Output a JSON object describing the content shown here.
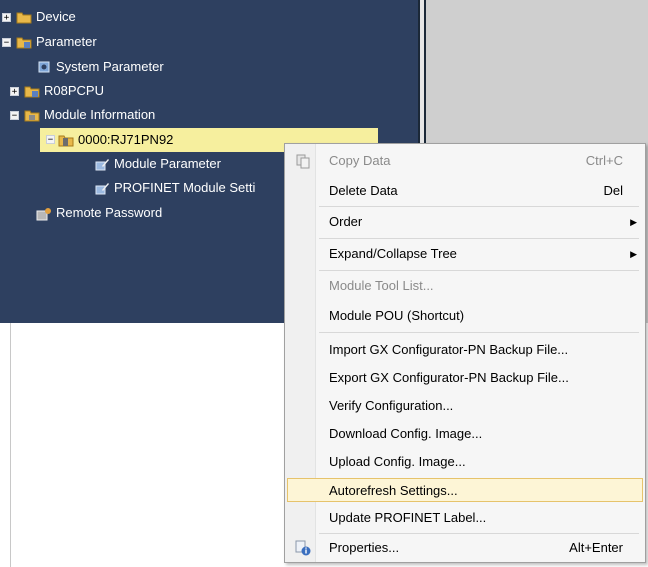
{
  "tree": {
    "items": [
      {
        "label": "Device",
        "expander": "+"
      },
      {
        "label": "Parameter",
        "expander": "−"
      },
      {
        "label": "System Parameter",
        "expander": ""
      },
      {
        "label": "R08PCPU",
        "expander": "+"
      },
      {
        "label": "Module Information",
        "expander": "−"
      },
      {
        "label": "0000:RJ71PN92",
        "expander": "−"
      },
      {
        "label": "Module Parameter",
        "expander": ""
      },
      {
        "label": "PROFINET Module Setti",
        "expander": ""
      },
      {
        "label": "Remote Password",
        "expander": ""
      }
    ]
  },
  "context_menu": {
    "items": [
      {
        "label": "Copy Data",
        "shortcut": "Ctrl+C",
        "disabled": true,
        "icon": "copy-icon"
      },
      {
        "label": "Delete Data",
        "shortcut": "Del"
      },
      {
        "label": "Order",
        "submenu": true
      },
      {
        "label": "Expand/Collapse Tree",
        "submenu": true
      },
      {
        "label": "Module Tool List...",
        "disabled": true
      },
      {
        "label": "Module POU (Shortcut)"
      },
      {
        "label": "Import GX Configurator-PN Backup File..."
      },
      {
        "label": "Export GX Configurator-PN Backup File..."
      },
      {
        "label": "Verify Configuration..."
      },
      {
        "label": "Download Config. Image..."
      },
      {
        "label": "Upload Config. Image..."
      },
      {
        "label": "Autorefresh Settings...",
        "highlighted": true
      },
      {
        "label": "Update PROFINET Label..."
      },
      {
        "label": "Properties...",
        "shortcut": "Alt+Enter",
        "icon": "properties-icon"
      }
    ]
  }
}
